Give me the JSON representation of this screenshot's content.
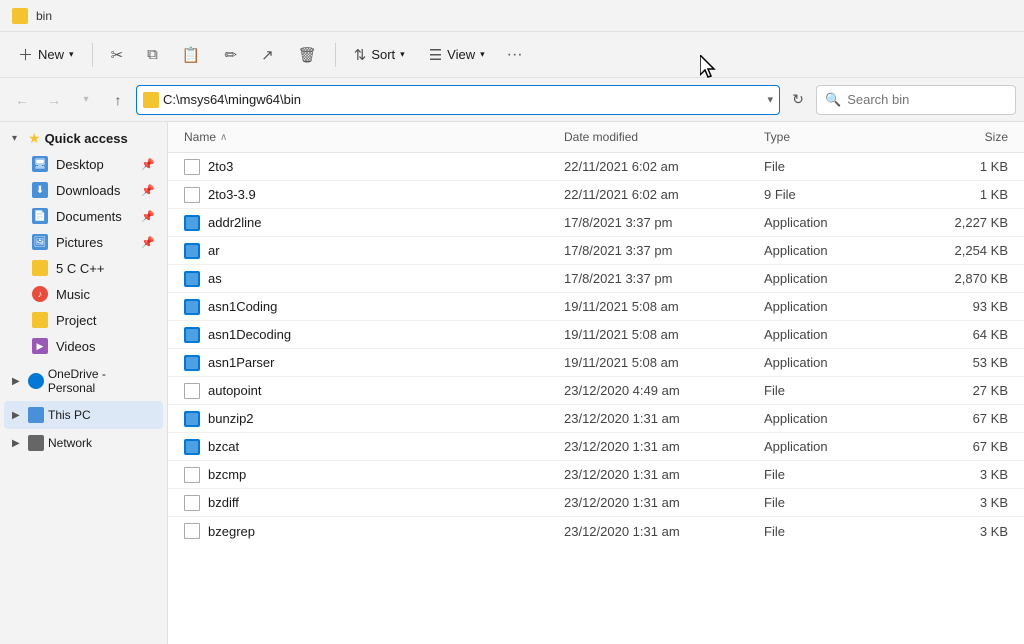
{
  "titleBar": {
    "title": "bin"
  },
  "toolbar": {
    "newLabel": "New",
    "sortLabel": "Sort",
    "viewLabel": "View",
    "moreLabel": "···"
  },
  "addressBar": {
    "path": "C:\\msys64\\mingw64\\bin",
    "searchPlaceholder": "Search bin"
  },
  "sidebar": {
    "quickAccessLabel": "Quick access",
    "items": [
      {
        "label": "Desktop",
        "iconType": "icon-desktop",
        "pinned": true
      },
      {
        "label": "Downloads",
        "iconType": "icon-downloads",
        "pinned": true
      },
      {
        "label": "Documents",
        "iconType": "icon-documents",
        "pinned": true
      },
      {
        "label": "Pictures",
        "iconType": "icon-pictures",
        "pinned": true
      },
      {
        "label": "5 C C++",
        "iconType": "icon-folder-yellow",
        "pinned": false
      },
      {
        "label": "Music",
        "iconType": "icon-music",
        "pinned": false
      },
      {
        "label": "Project",
        "iconType": "icon-folder-yellow",
        "pinned": false
      },
      {
        "label": "Videos",
        "iconType": "icon-videos",
        "pinned": false
      }
    ],
    "oneDriveLabel": "OneDrive - Personal",
    "thisPCLabel": "This PC",
    "networkLabel": "Network"
  },
  "fileListHeaders": {
    "name": "Name",
    "dateModified": "Date modified",
    "type": "Type",
    "size": "Size"
  },
  "files": [
    {
      "name": "2to3",
      "dateModified": "22/11/2021 6:02 am",
      "type": "File",
      "size": "1 KB",
      "isApp": false
    },
    {
      "name": "2to3-3.9",
      "dateModified": "22/11/2021 6:02 am",
      "type": "9 File",
      "size": "1 KB",
      "isApp": false
    },
    {
      "name": "addr2line",
      "dateModified": "17/8/2021 3:37 pm",
      "type": "Application",
      "size": "2,227 KB",
      "isApp": true
    },
    {
      "name": "ar",
      "dateModified": "17/8/2021 3:37 pm",
      "type": "Application",
      "size": "2,254 KB",
      "isApp": true
    },
    {
      "name": "as",
      "dateModified": "17/8/2021 3:37 pm",
      "type": "Application",
      "size": "2,870 KB",
      "isApp": true
    },
    {
      "name": "asn1Coding",
      "dateModified": "19/11/2021 5:08 am",
      "type": "Application",
      "size": "93 KB",
      "isApp": true
    },
    {
      "name": "asn1Decoding",
      "dateModified": "19/11/2021 5:08 am",
      "type": "Application",
      "size": "64 KB",
      "isApp": true
    },
    {
      "name": "asn1Parser",
      "dateModified": "19/11/2021 5:08 am",
      "type": "Application",
      "size": "53 KB",
      "isApp": true
    },
    {
      "name": "autopoint",
      "dateModified": "23/12/2020 4:49 am",
      "type": "File",
      "size": "27 KB",
      "isApp": false
    },
    {
      "name": "bunzip2",
      "dateModified": "23/12/2020 1:31 am",
      "type": "Application",
      "size": "67 KB",
      "isApp": true
    },
    {
      "name": "bzcat",
      "dateModified": "23/12/2020 1:31 am",
      "type": "Application",
      "size": "67 KB",
      "isApp": true
    },
    {
      "name": "bzcmp",
      "dateModified": "23/12/2020 1:31 am",
      "type": "File",
      "size": "3 KB",
      "isApp": false
    },
    {
      "name": "bzdiff",
      "dateModified": "23/12/2020 1:31 am",
      "type": "File",
      "size": "3 KB",
      "isApp": false
    },
    {
      "name": "bzegrep",
      "dateModified": "23/12/2020 1:31 am",
      "type": "File",
      "size": "3 KB",
      "isApp": false
    }
  ]
}
